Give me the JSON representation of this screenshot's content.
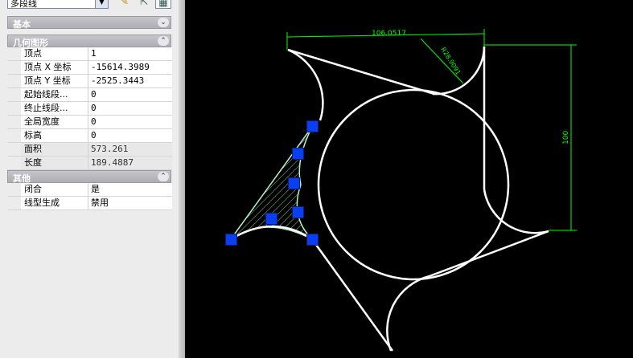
{
  "toolbar": {
    "selector_value": "多段线",
    "select_icon": "quick-select-icon",
    "pick_icon": "select-objects-icon",
    "toggle_icon": "toggle-pickadd-icon"
  },
  "sections": {
    "basic": {
      "title": "基本"
    },
    "geometry": {
      "title": "几何图形",
      "rows": [
        {
          "label": "顶点",
          "value": "1"
        },
        {
          "label": "顶点 X 坐标",
          "value": "-15614.3989"
        },
        {
          "label": "顶点 Y 坐标",
          "value": "-2525.3443"
        },
        {
          "label": "起始线段...",
          "value": "0"
        },
        {
          "label": "终止线段...",
          "value": "0"
        },
        {
          "label": "全局宽度",
          "value": "0"
        },
        {
          "label": "标高",
          "value": "0"
        },
        {
          "label": "面积",
          "value": "573.261"
        },
        {
          "label": "长度",
          "value": "189.4887"
        }
      ]
    },
    "misc": {
      "title": "其他",
      "rows": [
        {
          "label": "闭合",
          "value": "是"
        },
        {
          "label": "线型生成",
          "value": "禁用"
        }
      ]
    }
  },
  "drawing": {
    "dim_top": "106.0517",
    "dim_radius": "R28.9091",
    "dim_right": "100",
    "colors": {
      "geometry": "#ffffff",
      "dimension": "#00ff00",
      "hatch": "#8fd6b0",
      "grip": "#0a3ff0"
    }
  }
}
